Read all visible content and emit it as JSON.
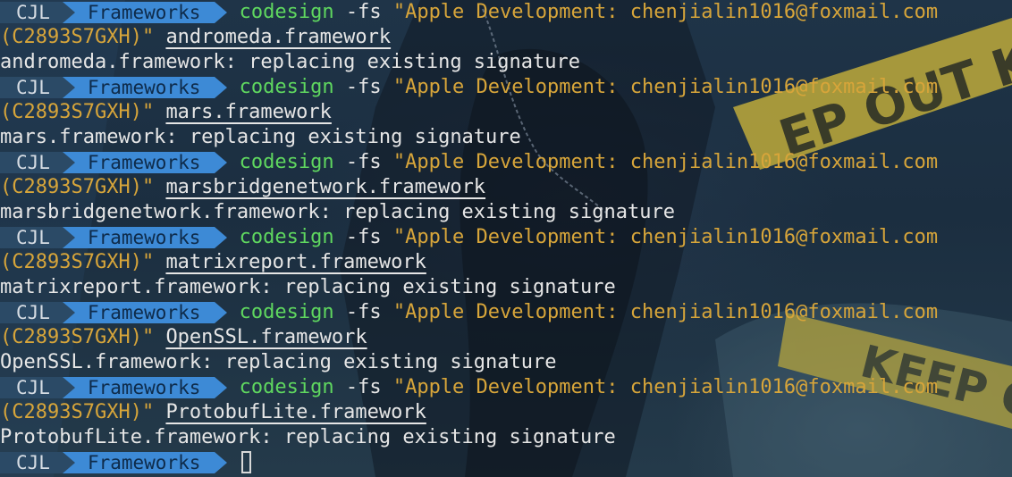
{
  "background": {
    "tape_text_1": "EP OUT KE",
    "tape_text_2": "KEEP O",
    "colors": {
      "base": "#1f3448",
      "tape": "#c9b23a"
    }
  },
  "prompt": {
    "user": "CJL",
    "dir": "Frameworks",
    "user_bg": "#2b4a66",
    "dir_bg": "#3d8ad6"
  },
  "entries": [
    {
      "cmd": "codesign",
      "flag": " -fs ",
      "identity_1": "\"Apple Development: chenjialin1016@foxmail.com",
      "identity_2": "(C2893S7GXH)\"",
      "target": "andromeda.framework",
      "output": "andromeda.framework: replacing existing signature"
    },
    {
      "cmd": "codesign",
      "flag": " -fs ",
      "identity_1": "\"Apple Development: chenjialin1016@foxmail.com",
      "identity_2": "(C2893S7GXH)\"",
      "target": "mars.framework",
      "output": "mars.framework: replacing existing signature"
    },
    {
      "cmd": "codesign",
      "flag": " -fs ",
      "identity_1": "\"Apple Development: chenjialin1016@foxmail.com",
      "identity_2": "(C2893S7GXH)\"",
      "target": "marsbridgenetwork.framework",
      "output": "marsbridgenetwork.framework: replacing existing signature"
    },
    {
      "cmd": "codesign",
      "flag": " -fs ",
      "identity_1": "\"Apple Development: chenjialin1016@foxmail.com",
      "identity_2": "(C2893S7GXH)\"",
      "target": "matrixreport.framework",
      "output": "matrixreport.framework: replacing existing signature"
    },
    {
      "cmd": "codesign",
      "flag": " -fs ",
      "identity_1": "\"Apple Development: chenjialin1016@foxmail.com",
      "identity_2": "(C2893S7GXH)\"",
      "target": "OpenSSL.framework",
      "output": "OpenSSL.framework: replacing existing signature"
    },
    {
      "cmd": "codesign",
      "flag": " -fs ",
      "identity_1": "\"Apple Development: chenjialin1016@foxmail.com",
      "identity_2": "(C2893S7GXH)\"",
      "target": "ProtobufLite.framework",
      "output": "ProtobufLite.framework: replacing existing signature"
    }
  ]
}
